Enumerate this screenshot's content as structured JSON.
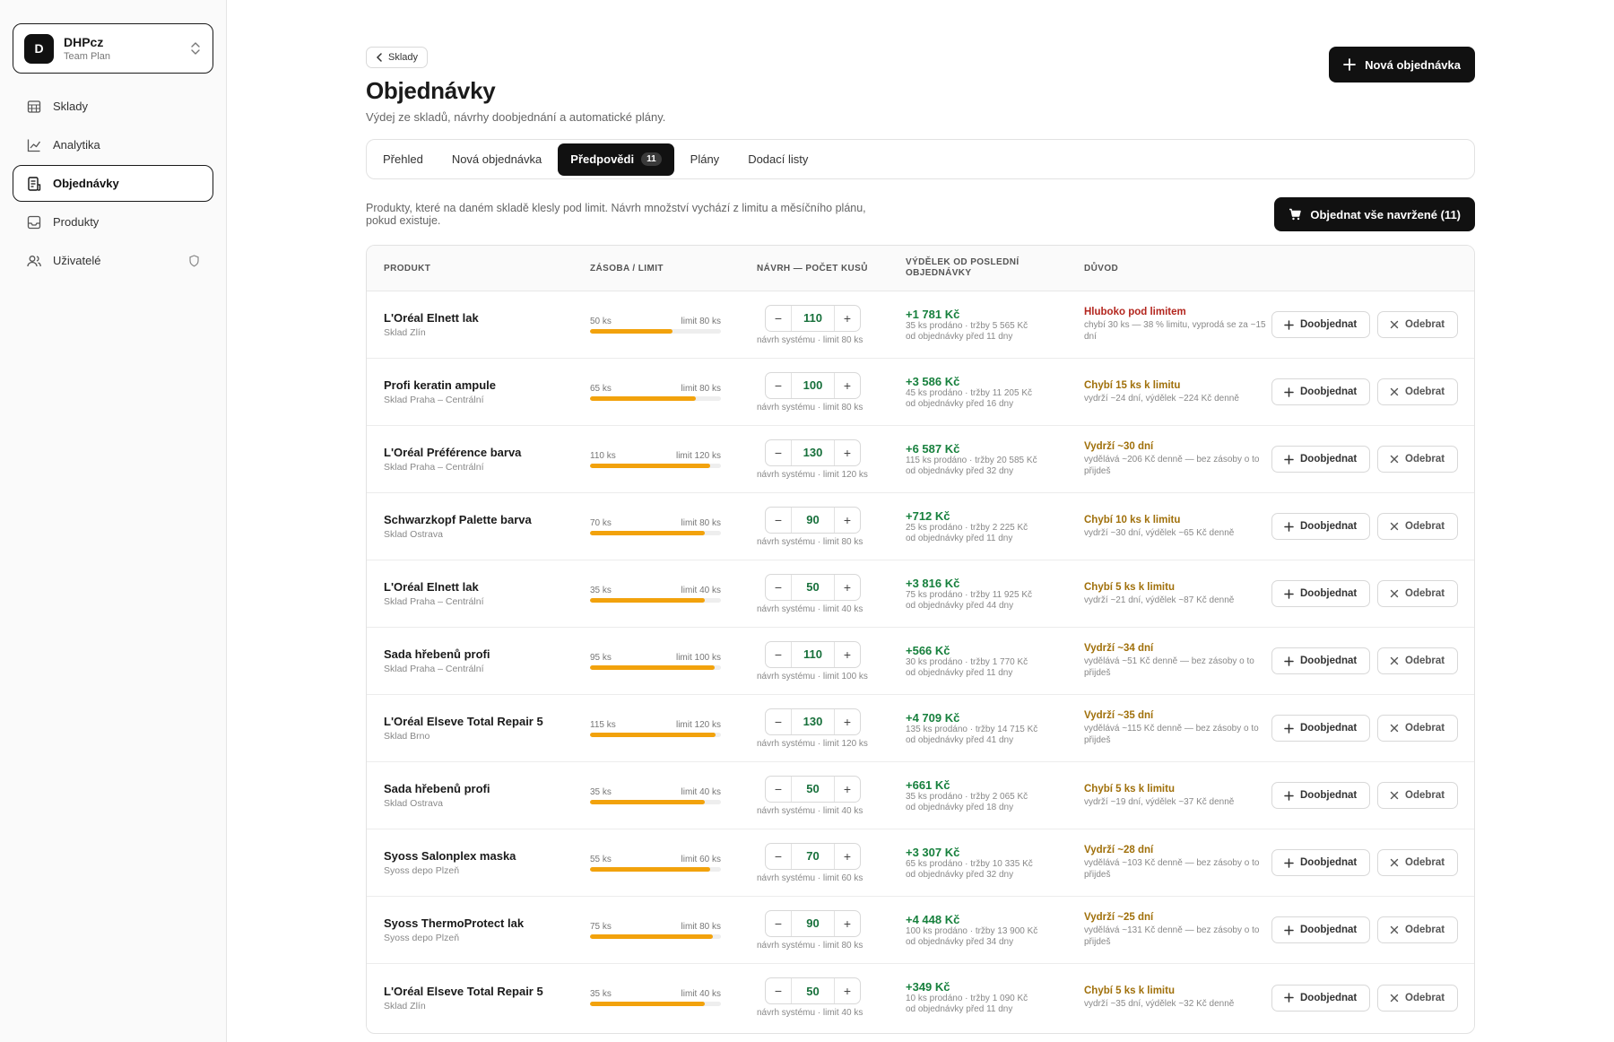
{
  "org": {
    "initial": "D",
    "name": "DHPcz",
    "plan": "Team Plan"
  },
  "sidebar": {
    "items": [
      {
        "label": "Sklady",
        "icon": "warehouse-icon"
      },
      {
        "label": "Analytika",
        "icon": "chart-icon"
      },
      {
        "label": "Objednávky",
        "icon": "orders-icon",
        "active": true
      },
      {
        "label": "Produkty",
        "icon": "inbox-icon"
      },
      {
        "label": "Uživatelé",
        "icon": "users-icon",
        "trail_icon": "shield-icon"
      }
    ]
  },
  "header": {
    "back_label": "Sklady",
    "title": "Objednávky",
    "subtitle": "Výdej ze skladů, návrhy doobjednání a automatické plány.",
    "new_order_label": "Nová objednávka"
  },
  "tabs": [
    {
      "label": "Přehled"
    },
    {
      "label": "Nová objednávka"
    },
    {
      "label": "Předpovědi",
      "badge": "11",
      "active": true
    },
    {
      "label": "Plány"
    },
    {
      "label": "Dodací listy"
    }
  ],
  "intro": {
    "text": "Produkty, které na daném skladě klesly pod limit. Návrh množství vychází z limitu a měsíčního plánu, pokud existuje.",
    "order_all_label": "Objednat vše navržené (11)"
  },
  "table": {
    "headers": {
      "product": "PRODUKT",
      "stock": "ZÁSOBA / LIMIT",
      "proposal": "NÁVRH — POČET KUSŮ",
      "earnings": "VÝDĚLEK OD POSLEDNÍ OBJEDNÁVKY",
      "reason": "DŮVOD"
    },
    "add_label": "Doobjednat",
    "remove_label": "Odebrat",
    "rows": [
      {
        "name": "L'Oréal Elnett lak",
        "warehouse": "Sklad Zlín",
        "stock": "50 ks",
        "limit": "limit 80 ks",
        "fill": 0.63,
        "qty": "110",
        "note": "návrh systému · limit 80 ks",
        "earn": "+1 781 Kč",
        "earn1": "35 ks prodáno · tržby 5 565 Kč",
        "earn2": "od objednávky před 11 dny",
        "reason": "Hluboko pod limitem",
        "severity": "red",
        "detail": "chybí 30 ks — 38 % limitu, vyprodá se za ~15 dní"
      },
      {
        "name": "Profi keratin ampule",
        "warehouse": "Sklad Praha – Centrální",
        "stock": "65 ks",
        "limit": "limit 80 ks",
        "fill": 0.81,
        "qty": "100",
        "note": "návrh systému · limit 80 ks",
        "earn": "+3 586 Kč",
        "earn1": "45 ks prodáno · tržby 11 205 Kč",
        "earn2": "od objednávky před 16 dny",
        "reason": "Chybí 15 ks k limitu",
        "severity": "amber",
        "detail": "vydrží ~24 dní, výdělek ~224 Kč denně"
      },
      {
        "name": "L'Oréal Préférence barva",
        "warehouse": "Sklad Praha – Centrální",
        "stock": "110 ks",
        "limit": "limit 120 ks",
        "fill": 0.92,
        "qty": "130",
        "note": "návrh systému · limit 120 ks",
        "earn": "+6 587 Kč",
        "earn1": "115 ks prodáno · tržby 20 585 Kč",
        "earn2": "od objednávky před 32 dny",
        "reason": "Vydrží ~30 dní",
        "severity": "amber",
        "detail": "vydělává ~206 Kč denně — bez zásoby o to přijdeš"
      },
      {
        "name": "Schwarzkopf Palette barva",
        "warehouse": "Sklad Ostrava",
        "stock": "70 ks",
        "limit": "limit 80 ks",
        "fill": 0.88,
        "qty": "90",
        "note": "návrh systému · limit 80 ks",
        "earn": "+712 Kč",
        "earn1": "25 ks prodáno · tržby 2 225 Kč",
        "earn2": "od objednávky před 11 dny",
        "reason": "Chybí 10 ks k limitu",
        "severity": "amber",
        "detail": "vydrží ~30 dní, výdělek ~65 Kč denně"
      },
      {
        "name": "L'Oréal Elnett lak",
        "warehouse": "Sklad Praha – Centrální",
        "stock": "35 ks",
        "limit": "limit 40 ks",
        "fill": 0.88,
        "qty": "50",
        "note": "návrh systému · limit 40 ks",
        "earn": "+3 816 Kč",
        "earn1": "75 ks prodáno · tržby 11 925 Kč",
        "earn2": "od objednávky před 44 dny",
        "reason": "Chybí 5 ks k limitu",
        "severity": "amber",
        "detail": "vydrží ~21 dní, výdělek ~87 Kč denně"
      },
      {
        "name": "Sada hřebenů profi",
        "warehouse": "Sklad Praha – Centrální",
        "stock": "95 ks",
        "limit": "limit 100 ks",
        "fill": 0.95,
        "qty": "110",
        "note": "návrh systému · limit 100 ks",
        "earn": "+566 Kč",
        "earn1": "30 ks prodáno · tržby 1 770 Kč",
        "earn2": "od objednávky před 11 dny",
        "reason": "Vydrží ~34 dní",
        "severity": "amber",
        "detail": "vydělává ~51 Kč denně — bez zásoby o to přijdeš"
      },
      {
        "name": "L'Oréal Elseve Total Repair 5",
        "warehouse": "Sklad Brno",
        "stock": "115 ks",
        "limit": "limit 120 ks",
        "fill": 0.96,
        "qty": "130",
        "note": "návrh systému · limit 120 ks",
        "earn": "+4 709 Kč",
        "earn1": "135 ks prodáno · tržby 14 715 Kč",
        "earn2": "od objednávky před 41 dny",
        "reason": "Vydrží ~35 dní",
        "severity": "amber",
        "detail": "vydělává ~115 Kč denně — bez zásoby o to přijdeš"
      },
      {
        "name": "Sada hřebenů profi",
        "warehouse": "Sklad Ostrava",
        "stock": "35 ks",
        "limit": "limit 40 ks",
        "fill": 0.88,
        "qty": "50",
        "note": "návrh systému · limit 40 ks",
        "earn": "+661 Kč",
        "earn1": "35 ks prodáno · tržby 2 065 Kč",
        "earn2": "od objednávky před 18 dny",
        "reason": "Chybí 5 ks k limitu",
        "severity": "amber",
        "detail": "vydrží ~19 dní, výdělek ~37 Kč denně"
      },
      {
        "name": "Syoss Salonplex maska",
        "warehouse": "Syoss depo Plzeň",
        "stock": "55 ks",
        "limit": "limit 60 ks",
        "fill": 0.92,
        "qty": "70",
        "note": "návrh systému · limit 60 ks",
        "earn": "+3 307 Kč",
        "earn1": "65 ks prodáno · tržby 10 335 Kč",
        "earn2": "od objednávky před 32 dny",
        "reason": "Vydrží ~28 dní",
        "severity": "amber",
        "detail": "vydělává ~103 Kč denně — bez zásoby o to přijdeš"
      },
      {
        "name": "Syoss ThermoProtect lak",
        "warehouse": "Syoss depo Plzeň",
        "stock": "75 ks",
        "limit": "limit 80 ks",
        "fill": 0.94,
        "qty": "90",
        "note": "návrh systému · limit 80 ks",
        "earn": "+4 448 Kč",
        "earn1": "100 ks prodáno · tržby 13 900 Kč",
        "earn2": "od objednávky před 34 dny",
        "reason": "Vydrží ~25 dní",
        "severity": "amber",
        "detail": "vydělává ~131 Kč denně — bez zásoby o to přijdeš"
      },
      {
        "name": "L'Oréal Elseve Total Repair 5",
        "warehouse": "Sklad Zlín",
        "stock": "35 ks",
        "limit": "limit 40 ks",
        "fill": 0.88,
        "qty": "50",
        "note": "návrh systému · limit 40 ks",
        "earn": "+349 Kč",
        "earn1": "10 ks prodáno · tržby 1 090 Kč",
        "earn2": "od objednávky před 11 dny",
        "reason": "Chybí 5 ks k limitu",
        "severity": "amber",
        "detail": "vydrží ~35 dní, výdělek ~32 Kč denně"
      }
    ]
  }
}
